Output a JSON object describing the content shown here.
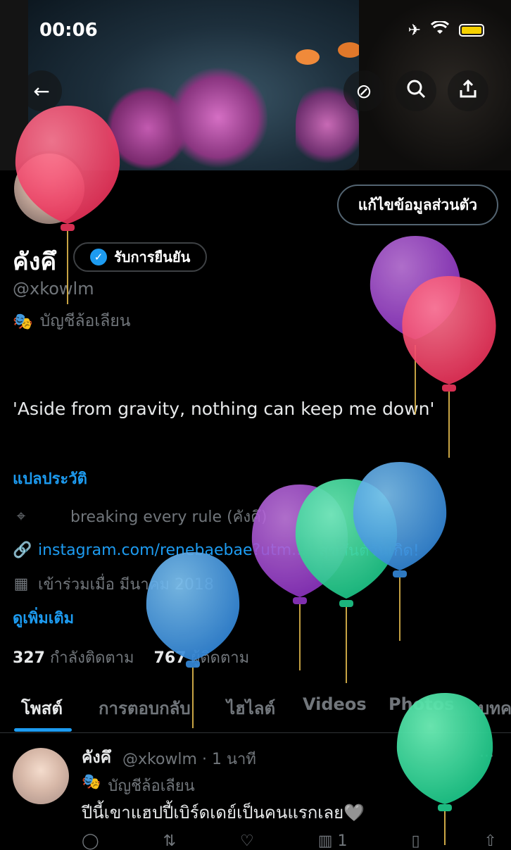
{
  "status_bar": {
    "time": "00:06"
  },
  "profile": {
    "edit_button": "แก้ไขข้อมูลส่วนตัว",
    "name": "คังคึ",
    "verify_label": "รับการยืนยัน",
    "handle": "@xkowlm",
    "parody_label": "บัญชีล้อเลียน",
    "bio": "'Aside from gravity, nothing can keep me down'",
    "translate_link": "แปลประวัติ",
    "location": "breaking every rule (คังคึ)",
    "website": "instagram.com/renebaebae?utm...",
    "birthday": "สุขสันต์วันเกิด!",
    "joined": "เข้าร่วมเมื่อ มีนาคม 2018",
    "see_more": "ดูเพิ่มเติม",
    "following_count": "327",
    "following_label": "กำลังติดตาม",
    "followers_count": "767",
    "followers_label": "ผู้ติดตาม"
  },
  "tabs": [
    "โพสต์",
    "การตอบกลับ",
    "ไฮไลต์",
    "Videos",
    "Photos",
    "บทค"
  ],
  "post": {
    "name": "คังคึ",
    "meta": "@xkowlm · 1 นาที",
    "parody_label": "บัญชีล้อเลียน",
    "text": "ปีนี้เขาแฮปปี้เบิร์ดเดย์เป็นคนแรกเลย🩶",
    "views": "1"
  },
  "colors": {
    "accent": "#1d9bf0",
    "battery": "#f5d000"
  }
}
